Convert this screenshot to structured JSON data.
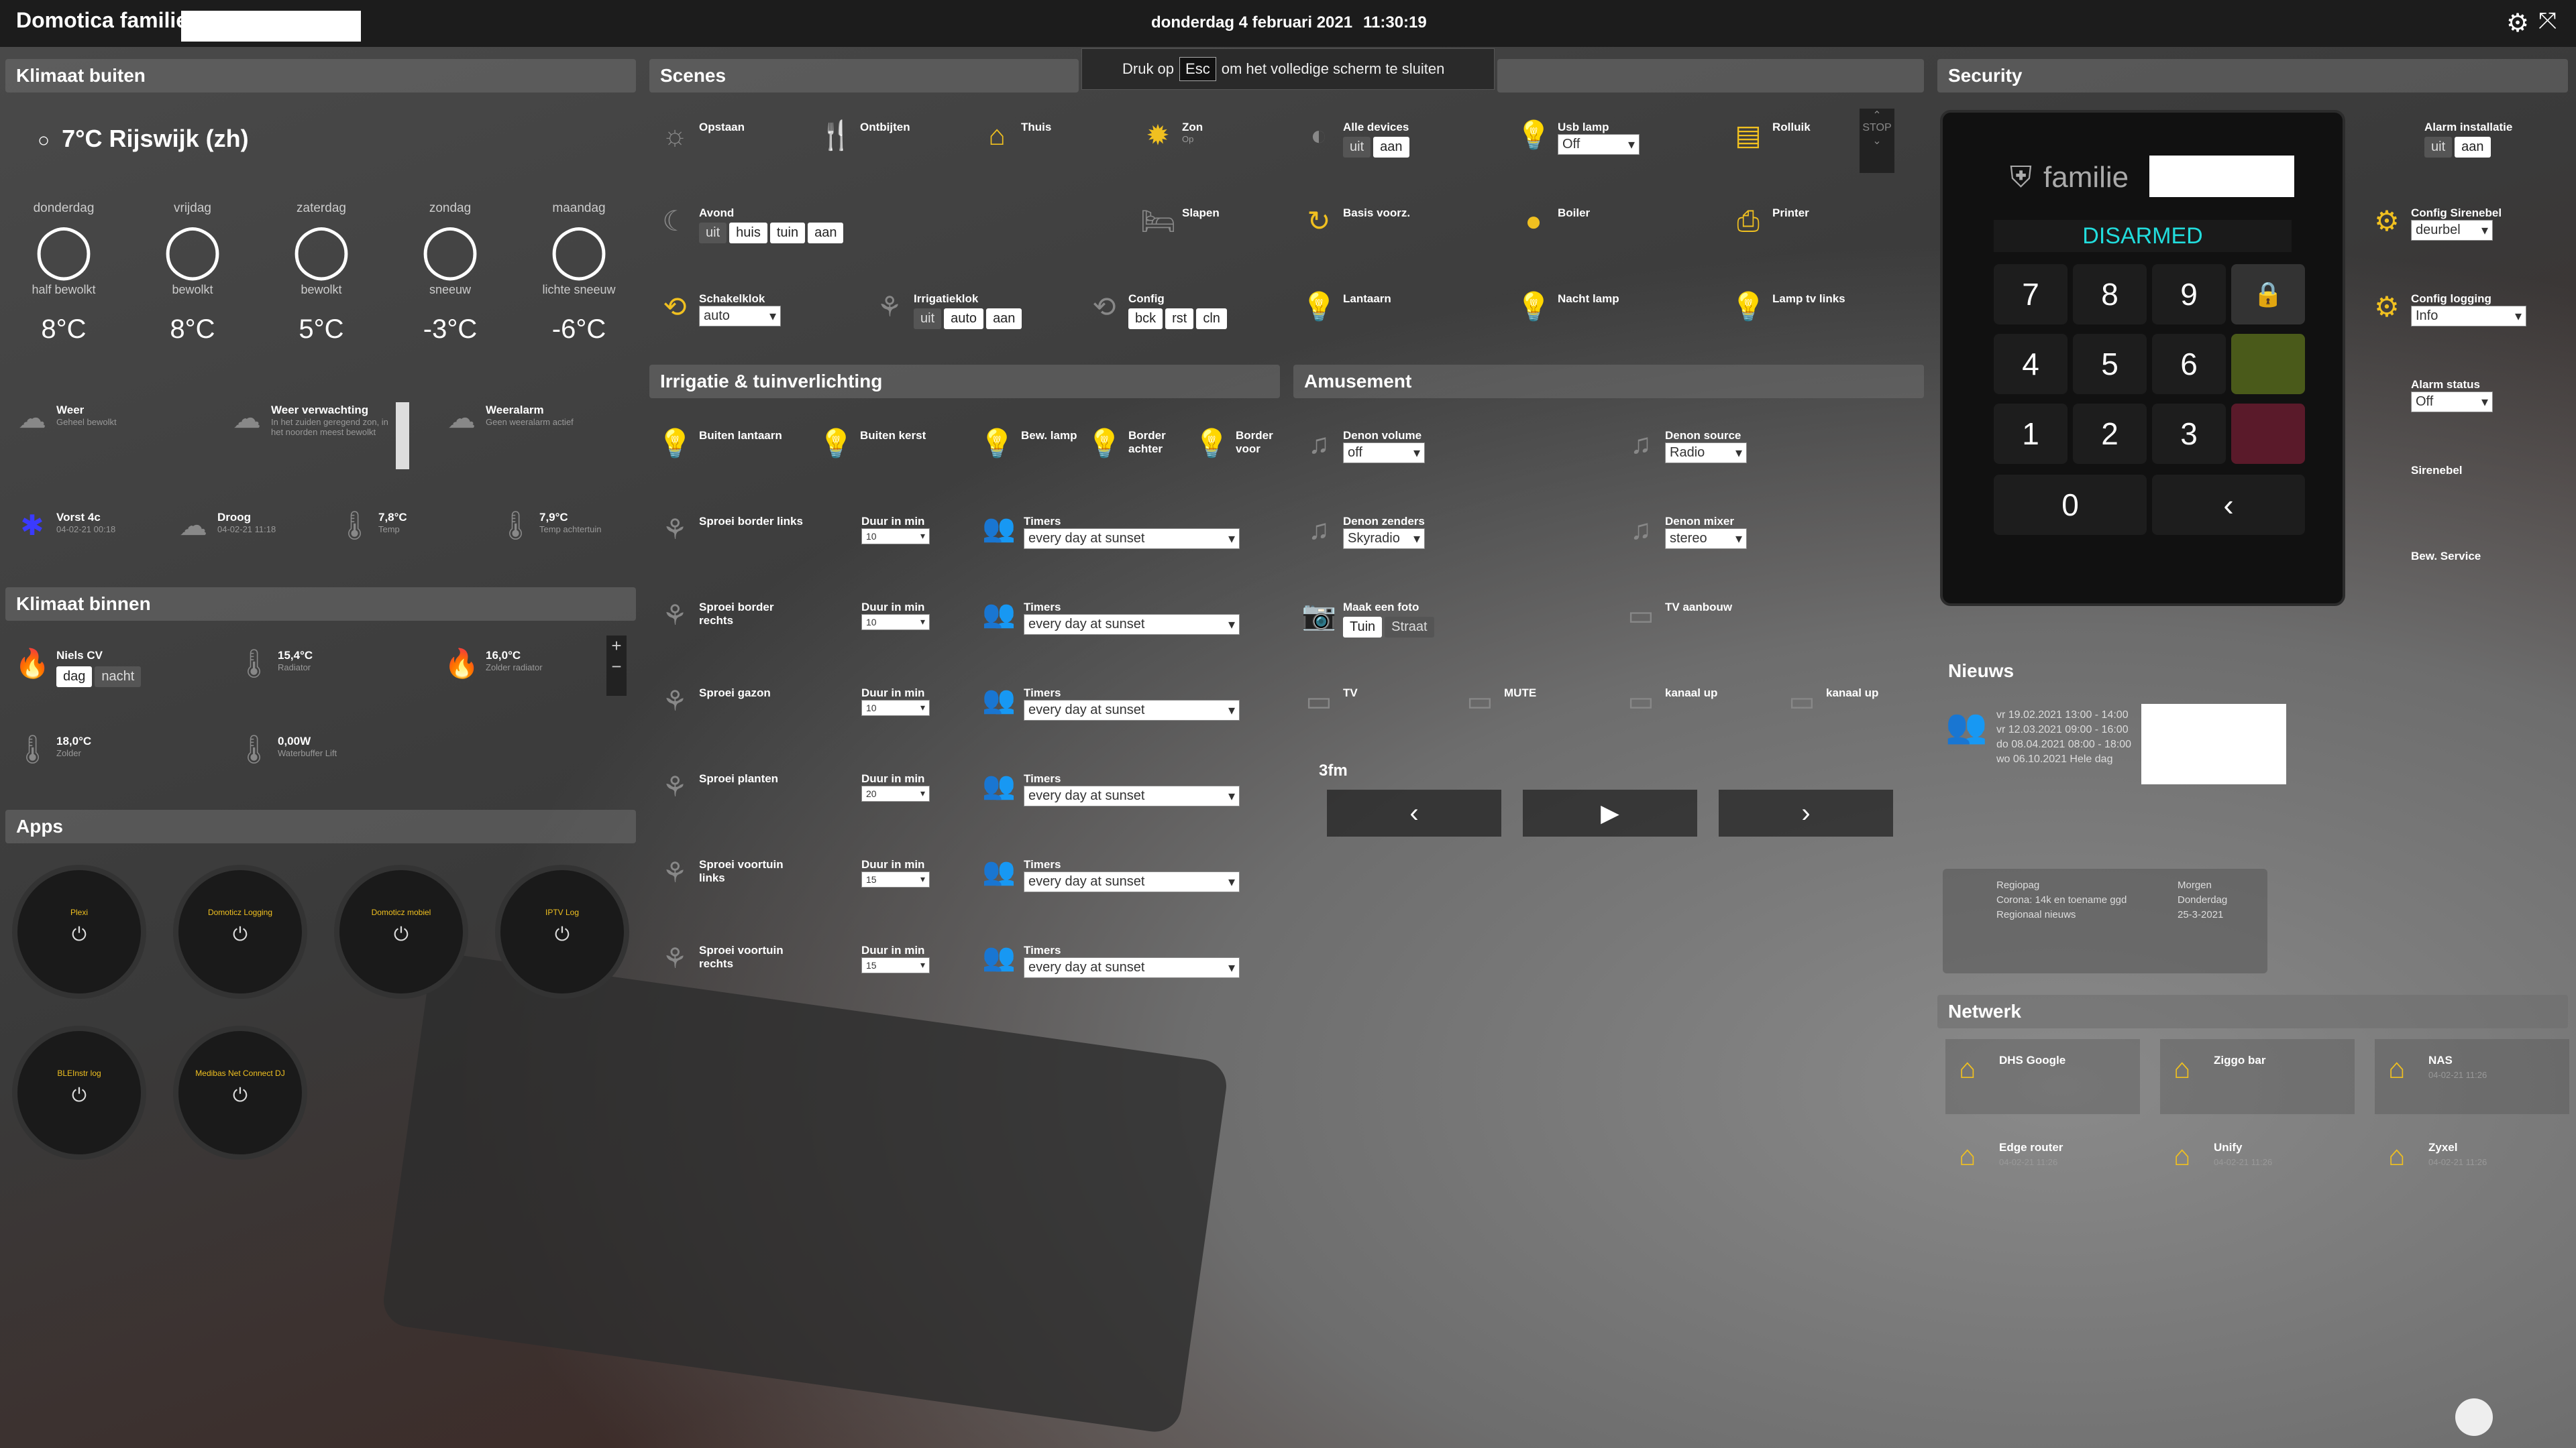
{
  "topbar": {
    "title": "Domotica familie",
    "date": "donderdag 4 februari 2021",
    "time": "11:30:19"
  },
  "esc": {
    "pre": "Druk op",
    "key": "Esc",
    "post": "om het volledige scherm te sluiten"
  },
  "sections": {
    "klimaat_buiten": "Klimaat buiten",
    "scenes": "Scenes",
    "security": "Security",
    "irrigatie": "Irrigatie & tuinverlichting",
    "amusement": "Amusement",
    "klimaat_binnen": "Klimaat binnen",
    "apps": "Apps",
    "nieuws": "Nieuws",
    "netwerk": "Netwerk"
  },
  "weather": {
    "current": "7°C Rijswijk (zh)",
    "days": [
      {
        "name": "donderdag",
        "desc": "half bewolkt",
        "temp": "8°C"
      },
      {
        "name": "vrijdag",
        "desc": "bewolkt",
        "temp": "8°C"
      },
      {
        "name": "zaterdag",
        "desc": "bewolkt",
        "temp": "5°C"
      },
      {
        "name": "zondag",
        "desc": "sneeuw",
        "temp": "-3°C"
      },
      {
        "name": "maandag",
        "desc": "lichte sneeuw",
        "temp": "-6°C"
      }
    ],
    "tiles": [
      {
        "name": "Weer",
        "sub": "Geheel bewolkt"
      },
      {
        "name": "Weer verwachting",
        "sub": "In het zuiden geregend zon, in het noorden meest bewolkt"
      },
      {
        "name": "Weeralarm",
        "sub": "Geen weeralarm actief"
      },
      {
        "name": "Vorst 4c",
        "sub": "04-02-21 00:18"
      },
      {
        "name": "Droog",
        "sub": "04-02-21 11:18"
      },
      {
        "name": "7,8°C",
        "sub": "Temp"
      },
      {
        "name": "7,9°C",
        "sub": "Temp achtertuin"
      }
    ]
  },
  "binnen": {
    "niels": "Niels CV",
    "dag": "dag",
    "nacht": "nacht",
    "t1": "15,4°C",
    "t1s": "Radiator",
    "t2": "16,0°C",
    "t2s": "Zolder radiator",
    "t3": "18,0°C",
    "t3s": "Zolder",
    "t4": "0,00W",
    "t4s": "Waterbuffer Lift"
  },
  "apps": [
    {
      "label": "Plexi"
    },
    {
      "label": "Domoticz Logging"
    },
    {
      "label": "Domoticz mobiel"
    },
    {
      "label": "IPTV Log"
    },
    {
      "label": "BLEInstr log"
    },
    {
      "label": "Medibas Net Connect DJ"
    }
  ],
  "scenes": {
    "opstaan": "Opstaan",
    "ontbijten": "Ontbijten",
    "thuis": "Thuis",
    "zon": "Zon",
    "zon_sub": "Op",
    "alle_devices": "Alle devices",
    "usb_lamp": "Usb lamp",
    "usb_off": "Off",
    "rolluik": "Rolluik",
    "avond": "Avond",
    "uit": "uit",
    "huis": "huis",
    "tuin": "tuin",
    "aan": "aan",
    "slapen": "Slapen",
    "basis": "Basis voorz.",
    "boiler": "Boiler",
    "printer": "Printer",
    "schakelklok": "Schakelklok",
    "auto": "auto",
    "irrigatieklok": "Irrigatieklok",
    "config": "Config",
    "bck": "bck",
    "rst": "rst",
    "cln": "cln",
    "lantaarn": "Lantaarn",
    "nacht_lamp": "Nacht lamp",
    "lamp_tv": "Lamp tv links",
    "stop": "STOP"
  },
  "irrigatie": {
    "lamps": [
      "Buiten lantaarn",
      "Buiten kerst",
      "Bew. lamp",
      "Border achter",
      "Border voor"
    ],
    "rows": [
      {
        "name": "Sproei border links",
        "duur": "10"
      },
      {
        "name": "Sproei border rechts",
        "duur": "10"
      },
      {
        "name": "Sproei gazon",
        "duur": "10"
      },
      {
        "name": "Sproei planten",
        "duur": "20"
      },
      {
        "name": "Sproei voortuin links",
        "duur": "15"
      },
      {
        "name": "Sproei voortuin rechts",
        "duur": "15"
      }
    ],
    "duur_label": "Duur in min",
    "timers_label": "Timers",
    "timer_value": "every day at sunset"
  },
  "amusement": {
    "denon_volume": "Denon volume",
    "volume_value": "off",
    "denon_source": "Denon source",
    "source_value": "Radio",
    "denon_zenders": "Denon zenders",
    "zenders_value": "Skyradio",
    "denon_mixer": "Denon mixer",
    "mixer_value": "stereo",
    "foto": "Maak een foto",
    "foto_b1": "Tuin",
    "foto_b2": "Straat",
    "tv_aanbouw": "TV aanbouw",
    "tv": "TV",
    "mute": "MUTE",
    "kanaal_up": "kanaal up",
    "kanaal_up2": "kanaal up",
    "radio_station": "3fm"
  },
  "security": {
    "brand": "familie",
    "status": "DISARMED",
    "keys": [
      "7",
      "8",
      "9",
      "4",
      "5",
      "6",
      "1",
      "2",
      "3",
      "0",
      "‹"
    ],
    "alarm_installatie": "Alarm installatie",
    "config_sirene": "Config Sirenebel",
    "sirene_value": "deurbel",
    "config_logging": "Config logging",
    "logging_value": "Info",
    "alarm_status": "Alarm status",
    "alarm_value": "Off",
    "sirenebel": "Sirenebel",
    "bew_service": "Bew. Service"
  },
  "news": {
    "rows": [
      "vr 19.02.2021   13:00 - 14:00",
      "vr 12.03.2021   09:00 - 16:00",
      "do 08.04.2021   08:00 - 18:00",
      "wo 06.10.2021   Hele dag"
    ],
    "small": [
      "Regiopag",
      "Corona: 14k en toename ggd",
      "Regionaal nieuws",
      "Morgen",
      "Donderdag",
      "25-3-2021"
    ]
  },
  "netwerk": [
    {
      "name": "DHS Google",
      "sub": ""
    },
    {
      "name": "Ziggo bar",
      "sub": ""
    },
    {
      "name": "NAS",
      "sub": "04-02-21 11:26"
    },
    {
      "name": "Edge router",
      "sub": "04-02-21 11:26"
    },
    {
      "name": "Unify",
      "sub": "04-02-21 11:26"
    },
    {
      "name": "Zyxel",
      "sub": "04-02-21 11:26"
    }
  ],
  "colors": {
    "accent": "#f0c020",
    "status": "#22dddd"
  }
}
